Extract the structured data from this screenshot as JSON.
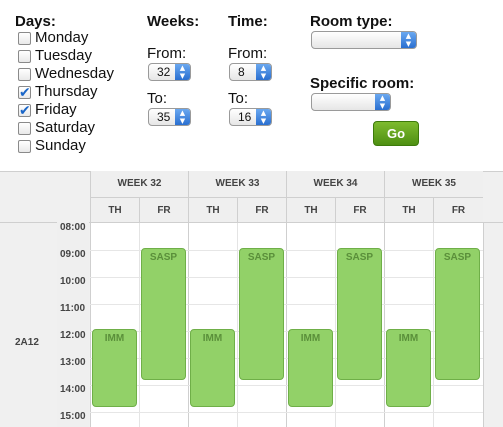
{
  "filters": {
    "days_label": "Days:",
    "days": [
      {
        "label": "Monday",
        "checked": false
      },
      {
        "label": "Tuesday",
        "checked": false
      },
      {
        "label": "Wednesday",
        "checked": false
      },
      {
        "label": "Thursday",
        "checked": true
      },
      {
        "label": "Friday",
        "checked": true
      },
      {
        "label": "Saturday",
        "checked": false
      },
      {
        "label": "Sunday",
        "checked": false
      }
    ],
    "weeks_label": "Weeks:",
    "weeks_from_label": "From:",
    "weeks_from_value": "32",
    "weeks_to_label": "To:",
    "weeks_to_value": "35",
    "time_label": "Time:",
    "time_from_label": "From:",
    "time_from_value": "8",
    "time_to_label": "To:",
    "time_to_value": "16",
    "room_type_label": "Room type:",
    "room_type_value": "",
    "specific_room_label": "Specific room:",
    "specific_room_value": "",
    "go_label": "Go"
  },
  "calendar": {
    "weeks": [
      "WEEK 32",
      "WEEK 33",
      "WEEK 34",
      "WEEK 35"
    ],
    "day_columns": [
      "TH",
      "FR",
      "TH",
      "FR",
      "TH",
      "FR",
      "TH",
      "FR"
    ],
    "times": [
      "08:00",
      "09:00",
      "10:00",
      "11:00",
      "12:00",
      "13:00",
      "14:00",
      "15:00"
    ],
    "room": "2A12",
    "events": [
      {
        "label": "IMM",
        "day": "TH",
        "week": "WEEK 32",
        "start": "12:00",
        "end": "14:45"
      },
      {
        "label": "SASP",
        "day": "FR",
        "week": "WEEK 32",
        "start": "09:00",
        "end": "13:45"
      },
      {
        "label": "IMM",
        "day": "TH",
        "week": "WEEK 33",
        "start": "12:00",
        "end": "14:45"
      },
      {
        "label": "SASP",
        "day": "FR",
        "week": "WEEK 33",
        "start": "09:00",
        "end": "13:45"
      },
      {
        "label": "IMM",
        "day": "TH",
        "week": "WEEK 34",
        "start": "12:00",
        "end": "14:45"
      },
      {
        "label": "SASP",
        "day": "FR",
        "week": "WEEK 34",
        "start": "09:00",
        "end": "13:45"
      },
      {
        "label": "IMM",
        "day": "TH",
        "week": "WEEK 35",
        "start": "12:00",
        "end": "14:45"
      },
      {
        "label": "SASP",
        "day": "FR",
        "week": "WEEK 35",
        "start": "09:00",
        "end": "13:45"
      }
    ]
  }
}
